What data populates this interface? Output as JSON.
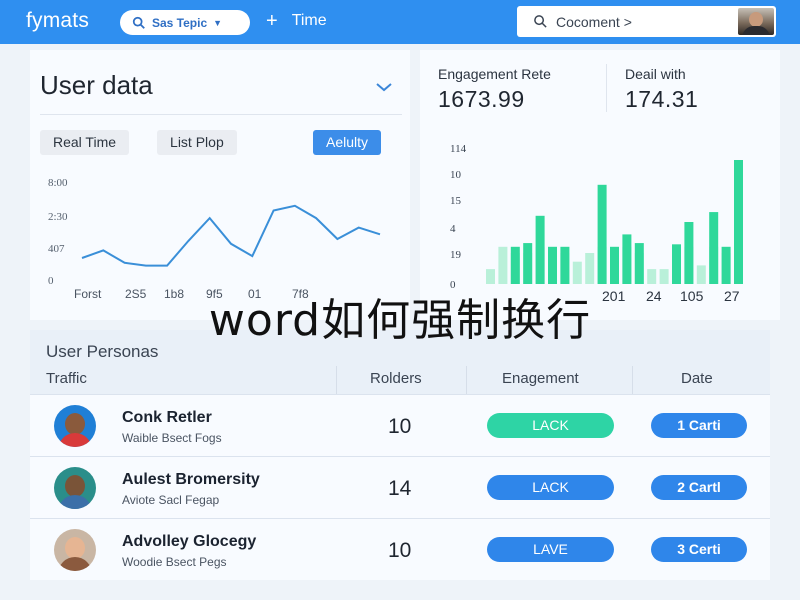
{
  "header": {
    "brand": "fymats",
    "search_pill_label": "Sas Tepic",
    "add_label": "Time",
    "comment_label": "Cocoment >",
    "icons": [
      "search-icon",
      "chevron-down-icon",
      "plus-icon",
      "user-avatar"
    ]
  },
  "user_data": {
    "title": "User data",
    "tabs": [
      "Real Time",
      "List Plop",
      "Aelulty"
    ],
    "active_tab": "Aelulty"
  },
  "engagement": {
    "stat_1_label": "Engagement Rete",
    "stat_1_value": "1673.99",
    "stat_2_label": "Deail with",
    "stat_2_value": "174.31"
  },
  "overlay_caption": "word如何强制换行",
  "personas": {
    "title": "User Personas",
    "columns": [
      "Traffic",
      "Rolders",
      "Enagement",
      "Date"
    ],
    "rows": [
      {
        "name": "Conk Retler",
        "sub": "Waible Bsect Fogs",
        "holders": "10",
        "engagement": "LACK",
        "date": "1 Carti"
      },
      {
        "name": "Aulest Bromersity",
        "sub": "Aviote Sacl Fegap",
        "holders": "14",
        "engagement": "LACK",
        "date": "2 Cartl"
      },
      {
        "name": "Advolley Glocegy",
        "sub": "Woodie Bsect Pegs",
        "holders": "10",
        "engagement": "LAVE",
        "date": "3 Certi"
      }
    ]
  },
  "colors": {
    "topbar": "#2f8ff0",
    "accent_blue": "#2f86ea",
    "accent_teal": "#2ed4a5",
    "bar_green": "#2fd89a",
    "bar_light": "#b9f0d9",
    "line_blue": "#3a8fd8"
  },
  "chart_data": [
    {
      "type": "line",
      "title": "",
      "y_ticks": [
        "8:00",
        "2:30",
        "407",
        "0"
      ],
      "x_ticks": [
        "Forst",
        "2S5",
        "1b8",
        "9f5",
        "01",
        "7f8"
      ],
      "values": [
        0.2,
        0.28,
        0.15,
        0.12,
        0.12,
        0.38,
        0.62,
        0.35,
        0.22,
        0.7,
        0.75,
        0.62,
        0.4,
        0.52,
        0.45
      ]
    },
    {
      "type": "bar",
      "title": "",
      "y_ticks": [
        "114",
        "10",
        "15",
        "4",
        "19",
        "0"
      ],
      "x_ticks": [
        "201",
        "24",
        "105",
        "27"
      ],
      "series": [
        {
          "values": [
            0,
            0,
            0.3,
            0.33,
            0.55,
            0.3,
            0.3,
            0,
            0,
            0.8,
            0.3,
            0.4,
            0.33,
            0,
            0,
            0.32,
            0.5,
            0,
            0.58,
            0.3,
            1.0
          ]
        },
        {
          "values": [
            0.12,
            0.3,
            0.25,
            0.25,
            0.3,
            0.22,
            0.25,
            0.18,
            0.25,
            0.3,
            0.25,
            0.3,
            0.25,
            0.12,
            0.12,
            0.3,
            0.3,
            0.15,
            0.3,
            0.25,
            0.3
          ]
        }
      ]
    }
  ]
}
